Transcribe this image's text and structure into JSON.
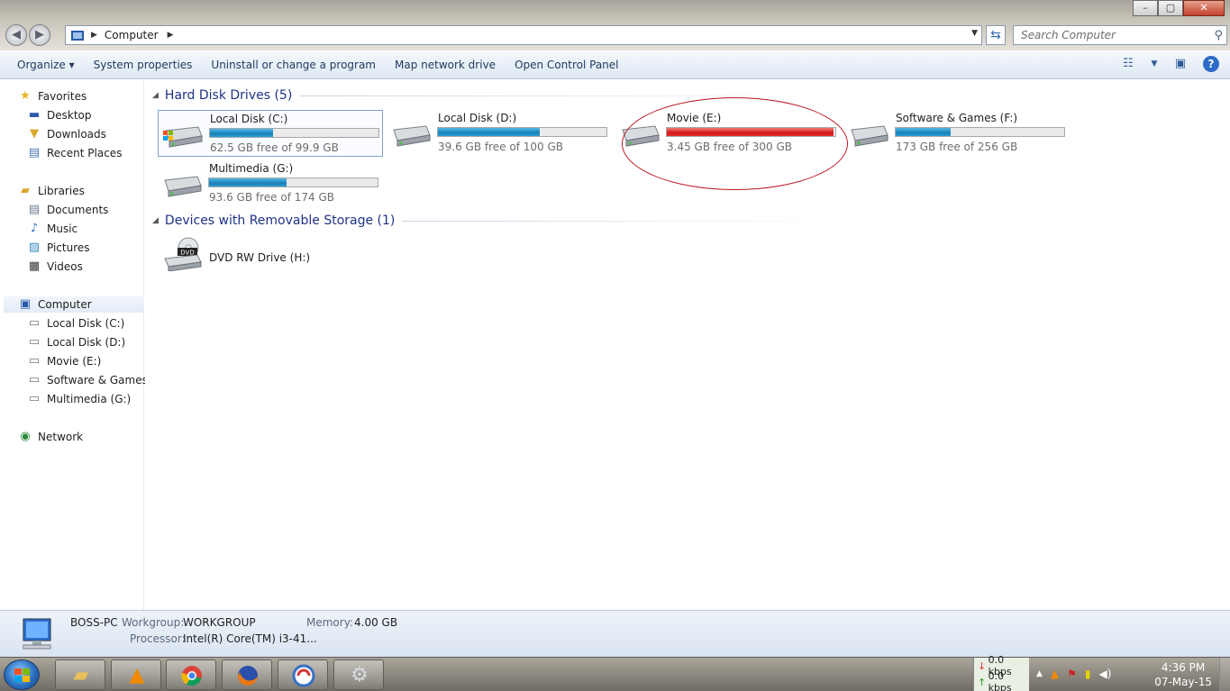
{
  "window": {
    "minimize": "–",
    "maximize": "▢",
    "close": "✕"
  },
  "address": {
    "crumbs": [
      "Computer"
    ],
    "search_placeholder": "Search Computer"
  },
  "toolbar": {
    "items": [
      "Organize ▾",
      "System properties",
      "Uninstall or change a program",
      "Map network drive",
      "Open Control Panel"
    ]
  },
  "nav": {
    "favorites": "Favorites",
    "desktop": "Desktop",
    "downloads": "Downloads",
    "recent": "Recent Places",
    "libraries": "Libraries",
    "documents": "Documents",
    "music": "Music",
    "pictures": "Pictures",
    "videos": "Videos",
    "computer": "Computer",
    "drive_c": "Local Disk (C:)",
    "drive_d": "Local Disk (D:)",
    "drive_e": "Movie (E:)",
    "drive_f": "Software & Games (",
    "drive_g": "Multimedia (G:)",
    "network": "Network"
  },
  "groups": {
    "hdd": "Hard Disk Drives (5)",
    "removable": "Devices with Removable Storage (1)"
  },
  "drives": [
    {
      "name": "Local Disk (C:)",
      "free": "62.5 GB free of 99.9 GB",
      "used_fraction": 0.374
    },
    {
      "name": "Local Disk (D:)",
      "free": "39.6 GB free of 100 GB",
      "used_fraction": 0.604
    },
    {
      "name": "Movie (E:)",
      "free": "3.45 GB free of 300 GB",
      "used_fraction": 0.988
    },
    {
      "name": "Software & Games (F:)",
      "free": "173 GB free of 256 GB",
      "used_fraction": 0.324
    },
    {
      "name": "Multimedia (G:)",
      "free": "93.6 GB free of 174 GB",
      "used_fraction": 0.462
    }
  ],
  "removable": {
    "name": "DVD RW Drive (H:)",
    "badge": "DVD"
  },
  "details": {
    "pc_name": "BOSS-PC",
    "workgroup_label": "Workgroup:",
    "workgroup_value": "WORKGROUP",
    "memory_label": "Memory:",
    "memory_value": "4.00 GB",
    "processor_label": "Processor:",
    "processor_value": "Intel(R) Core(TM) i3-41..."
  },
  "taskbar": {
    "down_speed": "0.0 kbps",
    "up_speed": "0.0 kbps",
    "time": "4:36 PM",
    "date": "07-May-15"
  },
  "colors": {
    "bar_normal": "#1a7fb6",
    "bar_critical": "#d41515",
    "header_text": "#1e3287"
  }
}
